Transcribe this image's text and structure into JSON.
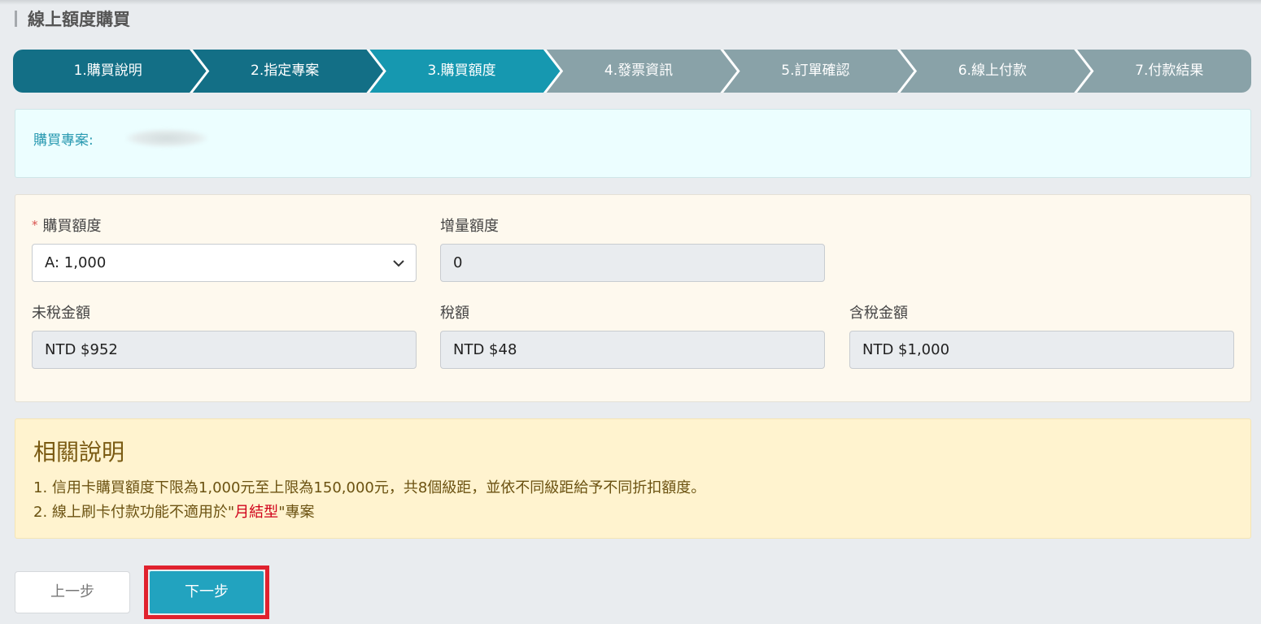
{
  "page": {
    "title": "線上額度購買"
  },
  "stepper": {
    "steps": [
      {
        "label": "1.購買說明",
        "state": "done"
      },
      {
        "label": "2.指定專案",
        "state": "done"
      },
      {
        "label": "3.購買額度",
        "state": "active"
      },
      {
        "label": "4.發票資訊",
        "state": "pending"
      },
      {
        "label": "5.訂單確認",
        "state": "pending"
      },
      {
        "label": "6.線上付款",
        "state": "pending"
      },
      {
        "label": "7.付款結果",
        "state": "pending"
      }
    ],
    "colors": {
      "done": "#136f86",
      "active": "#1698b0",
      "pending": "#89a2a8"
    }
  },
  "project": {
    "label": "購買專案:"
  },
  "form": {
    "purchase_amount": {
      "required_mark": "*",
      "label": "購買額度",
      "value": "A: 1,000"
    },
    "increment": {
      "label": "增量額度",
      "value": "0"
    },
    "pre_tax": {
      "label": "未稅金額",
      "value": "NTD $952"
    },
    "tax": {
      "label": "稅額",
      "value": "NTD $48"
    },
    "total": {
      "label": "含稅金額",
      "value": "NTD $1,000"
    }
  },
  "notes": {
    "title": "相關說明",
    "line1": "1. 信用卡購買額度下限為1,000元至上限為150,000元，共8個級距，並依不同級距給予不同折扣額度。",
    "line2_prefix": "2. 線上刷卡付款功能不適用於\"",
    "line2_highlight": "月結型",
    "line2_suffix": "\"專案"
  },
  "buttons": {
    "prev": "上一步",
    "next": "下一步"
  },
  "icons": {
    "dropdown": "chevron-down-icon"
  }
}
